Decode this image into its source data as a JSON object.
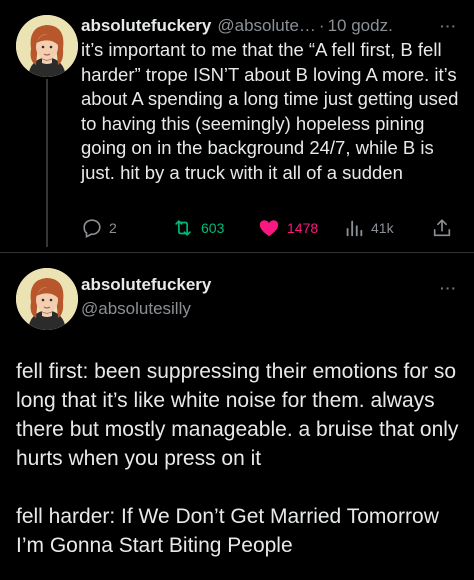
{
  "tweet1": {
    "display_name": "absolutefuckery",
    "handle": "@absolute…",
    "separator": "·",
    "time": "10 godz.",
    "more_label": "···",
    "text": "it’s important to me that the “A fell first, B fell harder” trope ISN’T about B loving A more. it’s about A spending a long time just getting used to having this (seemingly) hopeless pining going on in the background 24/7, while B is just. hit by a truck with it all of a sudden",
    "actions": {
      "replies": "2",
      "reposts": "603",
      "likes": "1478",
      "views": "41k"
    }
  },
  "tweet2": {
    "display_name": "absolutefuckery",
    "handle": "@absolutesilly",
    "more_label": "···",
    "paragraphs": [
      "fell first: been suppressing their emotions for so long that it’s like white noise for them. always there but mostly manageable. a bruise that only hurts when you press on it",
      "fell harder: If We Don’t Get Married Tomorrow I’m Gonna Start Biting People"
    ]
  },
  "colors": {
    "background": "#000000",
    "text": "#e7e9ea",
    "muted": "#8b9095",
    "like": "#f91880",
    "repost": "#00ba7c",
    "avatar_bg": "#e9e1b3"
  },
  "icons": [
    "reply-icon",
    "repost-icon",
    "like-icon",
    "views-icon",
    "share-icon",
    "more-icon"
  ]
}
